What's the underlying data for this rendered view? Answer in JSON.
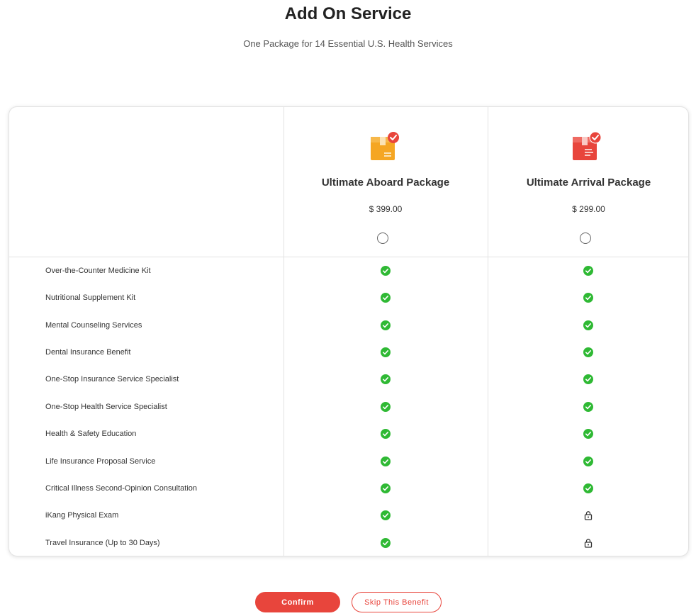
{
  "header": {
    "title": "Add On Service",
    "subtitle": "One Package for 14 Essential U.S. Health Services"
  },
  "packages": [
    {
      "name": "Ultimate Aboard Package",
      "price": "$ 399.00",
      "icon": "package-box-icon",
      "color": "#f5a623",
      "selected": false
    },
    {
      "name": "Ultimate Arrival Package",
      "price": "$ 299.00",
      "icon": "package-box-icon",
      "color": "#e8453c",
      "selected": false
    }
  ],
  "features": [
    {
      "label": "Over-the-Counter Medicine Kit",
      "aboard": "included",
      "arrival": "included"
    },
    {
      "label": "Nutritional Supplement Kit",
      "aboard": "included",
      "arrival": "included"
    },
    {
      "label": "Mental Counseling Services",
      "aboard": "included",
      "arrival": "included"
    },
    {
      "label": "Dental Insurance Benefit",
      "aboard": "included",
      "arrival": "included"
    },
    {
      "label": "One-Stop Insurance Service Specialist",
      "aboard": "included",
      "arrival": "included"
    },
    {
      "label": "One-Stop Health Service Specialist",
      "aboard": "included",
      "arrival": "included"
    },
    {
      "label": "Health & Safety Education",
      "aboard": "included",
      "arrival": "included"
    },
    {
      "label": "Life Insurance Proposal Service",
      "aboard": "included",
      "arrival": "included"
    },
    {
      "label": "Critical Illness Second-Opinion Consultation",
      "aboard": "included",
      "arrival": "included"
    },
    {
      "label": "iKang Physical Exam",
      "aboard": "included",
      "arrival": "locked"
    },
    {
      "label": "Travel Insurance (Up to 30 Days)",
      "aboard": "included",
      "arrival": "locked"
    }
  ],
  "actions": {
    "confirm_label": "Confirm",
    "skip_label": "Skip This Benefit"
  },
  "colors": {
    "accent": "#e8453c",
    "check": "#2fb934",
    "lock": "#333333"
  }
}
